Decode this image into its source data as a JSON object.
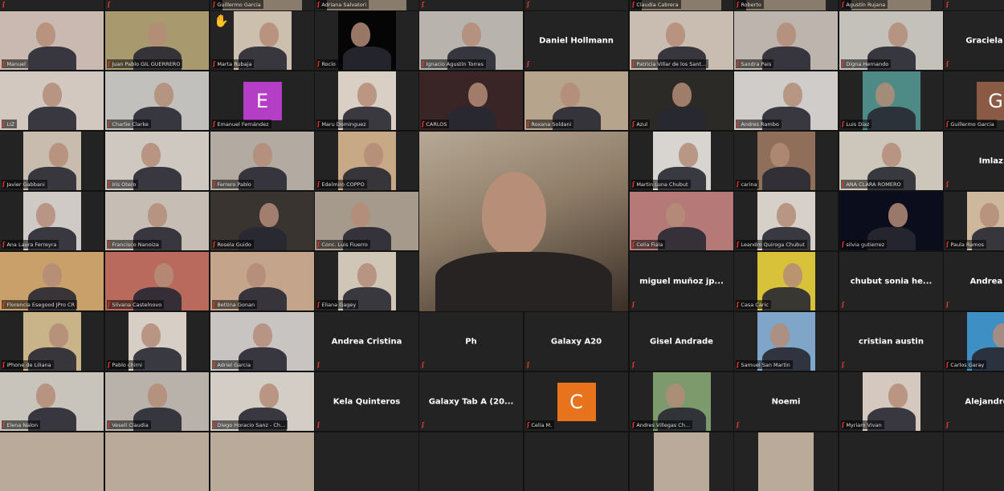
{
  "app": "Zoom gallery view",
  "icons": {
    "muted": "muted-microphone-icon",
    "raised_hand": "raised-hand-icon"
  },
  "colors": {
    "muted": "#e0382b",
    "tile_bg": "#232323",
    "background": "#121212"
  },
  "top_partial_row": [
    {
      "name": ""
    },
    {
      "name": ""
    },
    {
      "name": "Guillermo Garcia"
    },
    {
      "name": "Adriana Salvatori"
    },
    {
      "name": ""
    },
    {
      "name": ""
    },
    {
      "name": "Claudia Cabrera"
    },
    {
      "name": "Roberto"
    },
    {
      "name": "Agustín Rujana"
    },
    {
      "name": ""
    }
  ],
  "rows": [
    [
      {
        "name": "Manuel",
        "type": "video",
        "bg": "#c9b9b0"
      },
      {
        "name": "Juan Pablo GIL GUERRERO",
        "type": "video",
        "bg": "#a89a6e"
      },
      {
        "name": "Marta Rubaja",
        "type": "small-video",
        "bg": "#cdbfae",
        "raised_hand": true
      },
      {
        "name": "Rocío",
        "type": "small-video",
        "bg": "#050505"
      },
      {
        "name": "Ignacio Agustín Torres",
        "type": "video",
        "bg": "#b9b3ad"
      },
      {
        "name": "Daniel Hollmann",
        "type": "name"
      },
      {
        "name": "Patricia Villar de los Sant...",
        "type": "video",
        "bg": "#c9bcb0"
      },
      {
        "name": "Sandra Pais",
        "type": "video",
        "bg": "#bdb5ad"
      },
      {
        "name": "Digna Hernando",
        "type": "video",
        "bg": "#c4c0ba"
      },
      {
        "name": "Graciela Lo...",
        "type": "name"
      }
    ],
    [
      {
        "name": "LIZ",
        "type": "video",
        "bg": "#d2c8c0"
      },
      {
        "name": "Charlie Clarke",
        "type": "video",
        "bg": "#c2c0bd"
      },
      {
        "name": "Emanuel Fernández",
        "type": "initial",
        "initial": "E",
        "color": "#b43fc6"
      },
      {
        "name": "Maru Dominguez",
        "type": "small-video",
        "bg": "#d9cfc4"
      },
      {
        "name": "CARLOS",
        "type": "video",
        "bg": "#3a2526"
      },
      {
        "name": "Roxana Soldani",
        "type": "video",
        "bg": "#b7a48c"
      },
      {
        "name": "Azul",
        "type": "video",
        "bg": "#2b2a26"
      },
      {
        "name": "Andres Rambo",
        "type": "video",
        "bg": "#cfccc9"
      },
      {
        "name": "Luis Diaz",
        "type": "small-video",
        "bg": "#4e8a86"
      },
      {
        "name": "Guillermo Garcia",
        "type": "initial",
        "initial": "G",
        "color": "#8a5a44"
      }
    ],
    [
      {
        "name": "Javier Gabbani",
        "type": "small-video",
        "bg": "#c8bcae"
      },
      {
        "name": "Iris Otero",
        "type": "video",
        "bg": "#cfc8c0"
      },
      {
        "name": "Ferrero Pablo",
        "type": "video",
        "bg": "#b3aba2"
      },
      {
        "name": "Edelmiro COPPO",
        "type": "small-video",
        "bg": "#c7a985"
      },
      null,
      null,
      {
        "name": "Martin Luna Chubut",
        "type": "small-video",
        "bg": "#d8d4cf"
      },
      {
        "name": "carina",
        "type": "small-video",
        "bg": "#8f6e5a"
      },
      {
        "name": "ANA CLARA ROMERO",
        "type": "video",
        "bg": "#cdc6bb"
      },
      {
        "name": "Imlaz...",
        "type": "name"
      }
    ],
    [
      {
        "name": "Ana Laura Ferreyra",
        "type": "small-video",
        "bg": "#cfcac6"
      },
      {
        "name": "Francisco Nanoiza",
        "type": "video",
        "bg": "#c6beb4"
      },
      {
        "name": "Rosela Guido",
        "type": "video",
        "bg": "#3a3431"
      },
      {
        "name": "Conc. Luis Fiuerro",
        "type": "video",
        "bg": "#a69a8c"
      },
      null,
      null,
      {
        "name": "Celia Fiala",
        "type": "video",
        "bg": "#b57a78"
      },
      {
        "name": "Leandro Quiroga Chubut",
        "type": "small-video",
        "bg": "#d6d0c8"
      },
      {
        "name": "silvia gutierrez",
        "type": "video",
        "bg": "#0b0d1c"
      },
      {
        "name": "Paula Ramos",
        "type": "small-video",
        "bg": "#cdb89e"
      }
    ],
    [
      {
        "name": "Florencia Esegood JPro CR",
        "type": "video",
        "bg": "#c9a06a"
      },
      {
        "name": "Silvana Castelnovo",
        "type": "video",
        "bg": "#b96a5c"
      },
      {
        "name": "Bettina Gonan",
        "type": "video",
        "bg": "#c4a48a"
      },
      {
        "name": "Eliana Gagey",
        "type": "small-video",
        "bg": "#d0c6b8"
      },
      null,
      null,
      {
        "name": "miguel muñoz jp...",
        "type": "name"
      },
      {
        "name": "Casa Caric",
        "type": "small-video",
        "bg": "#d8c23a"
      },
      {
        "name": "chubut sonia he...",
        "type": "name"
      },
      {
        "name": "Andrea D...",
        "type": "name"
      }
    ],
    [
      {
        "name": "iPhone de Liliana",
        "type": "small-video",
        "bg": "#c9b389"
      },
      {
        "name": "Pablo chirni",
        "type": "small-video",
        "bg": "#d7cfc6"
      },
      {
        "name": "Adriel Garcia",
        "type": "video",
        "bg": "#c7c4c1"
      },
      {
        "name": "Andrea Cristina",
        "type": "name"
      },
      {
        "name": "Ph",
        "type": "name"
      },
      {
        "name": "Galaxy A20",
        "type": "name"
      },
      {
        "name": "Gisel Andrade",
        "type": "name"
      },
      {
        "name": "Samuel San Martin",
        "type": "small-video",
        "bg": "#7fa6c8"
      },
      {
        "name": "cristian austin",
        "type": "name"
      },
      {
        "name": "Carlos Garay",
        "type": "small-video",
        "bg": "#3d8fc4"
      }
    ],
    [
      {
        "name": "Elena Nalon",
        "type": "video",
        "bg": "#c8c4bc"
      },
      {
        "name": "Veselí Claudia",
        "type": "video",
        "bg": "#b8b2ab"
      },
      {
        "name": "Diego Horacio Sanz - Ch...",
        "type": "video",
        "bg": "#d4cdc6"
      },
      {
        "name": "Kela Quinteros",
        "type": "name"
      },
      {
        "name": "Galaxy Tab A (20...",
        "type": "name"
      },
      {
        "name": "Celia M.",
        "type": "initial",
        "initial": "C",
        "color": "#e8731d"
      },
      {
        "name": "Andres Villegas Ch...",
        "type": "small-video",
        "bg": "#7c9a6c"
      },
      {
        "name": "Noemi",
        "type": "name"
      },
      {
        "name": "Myriam Vivan",
        "type": "small-video",
        "bg": "#d5c8be"
      },
      {
        "name": "Alejandro S...",
        "type": "name"
      }
    ]
  ],
  "featured": {
    "name": "",
    "type": "video",
    "bg": "#a8977f"
  }
}
